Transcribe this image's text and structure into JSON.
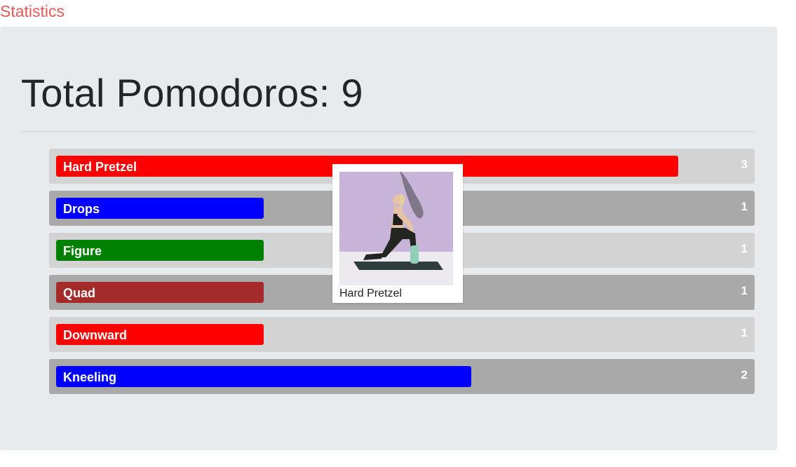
{
  "nav": {
    "statistics_link": "Statistics"
  },
  "summary": {
    "title": "Total Pomodoros: 9",
    "total": 9
  },
  "max_count": 3,
  "rows": [
    {
      "name": "Hard Pretzel",
      "count": "3",
      "value": 3,
      "color": "#ff0000",
      "shade": "light"
    },
    {
      "name": "Drops",
      "count": "1",
      "value": 1,
      "color": "#0000ff",
      "shade": "dark"
    },
    {
      "name": "Figure",
      "count": "1",
      "value": 1,
      "color": "#008000",
      "shade": "light"
    },
    {
      "name": "Quad",
      "count": "1",
      "value": 1,
      "color": "#a52a2a",
      "shade": "dark"
    },
    {
      "name": "Downward",
      "count": "1",
      "value": 1,
      "color": "#ff0000",
      "shade": "light"
    },
    {
      "name": "Kneeling",
      "count": "2",
      "value": 2,
      "color": "#0000ff",
      "shade": "dark"
    }
  ],
  "tooltip": {
    "caption": "Hard Pretzel",
    "image": "yoga-pose-photo"
  }
}
